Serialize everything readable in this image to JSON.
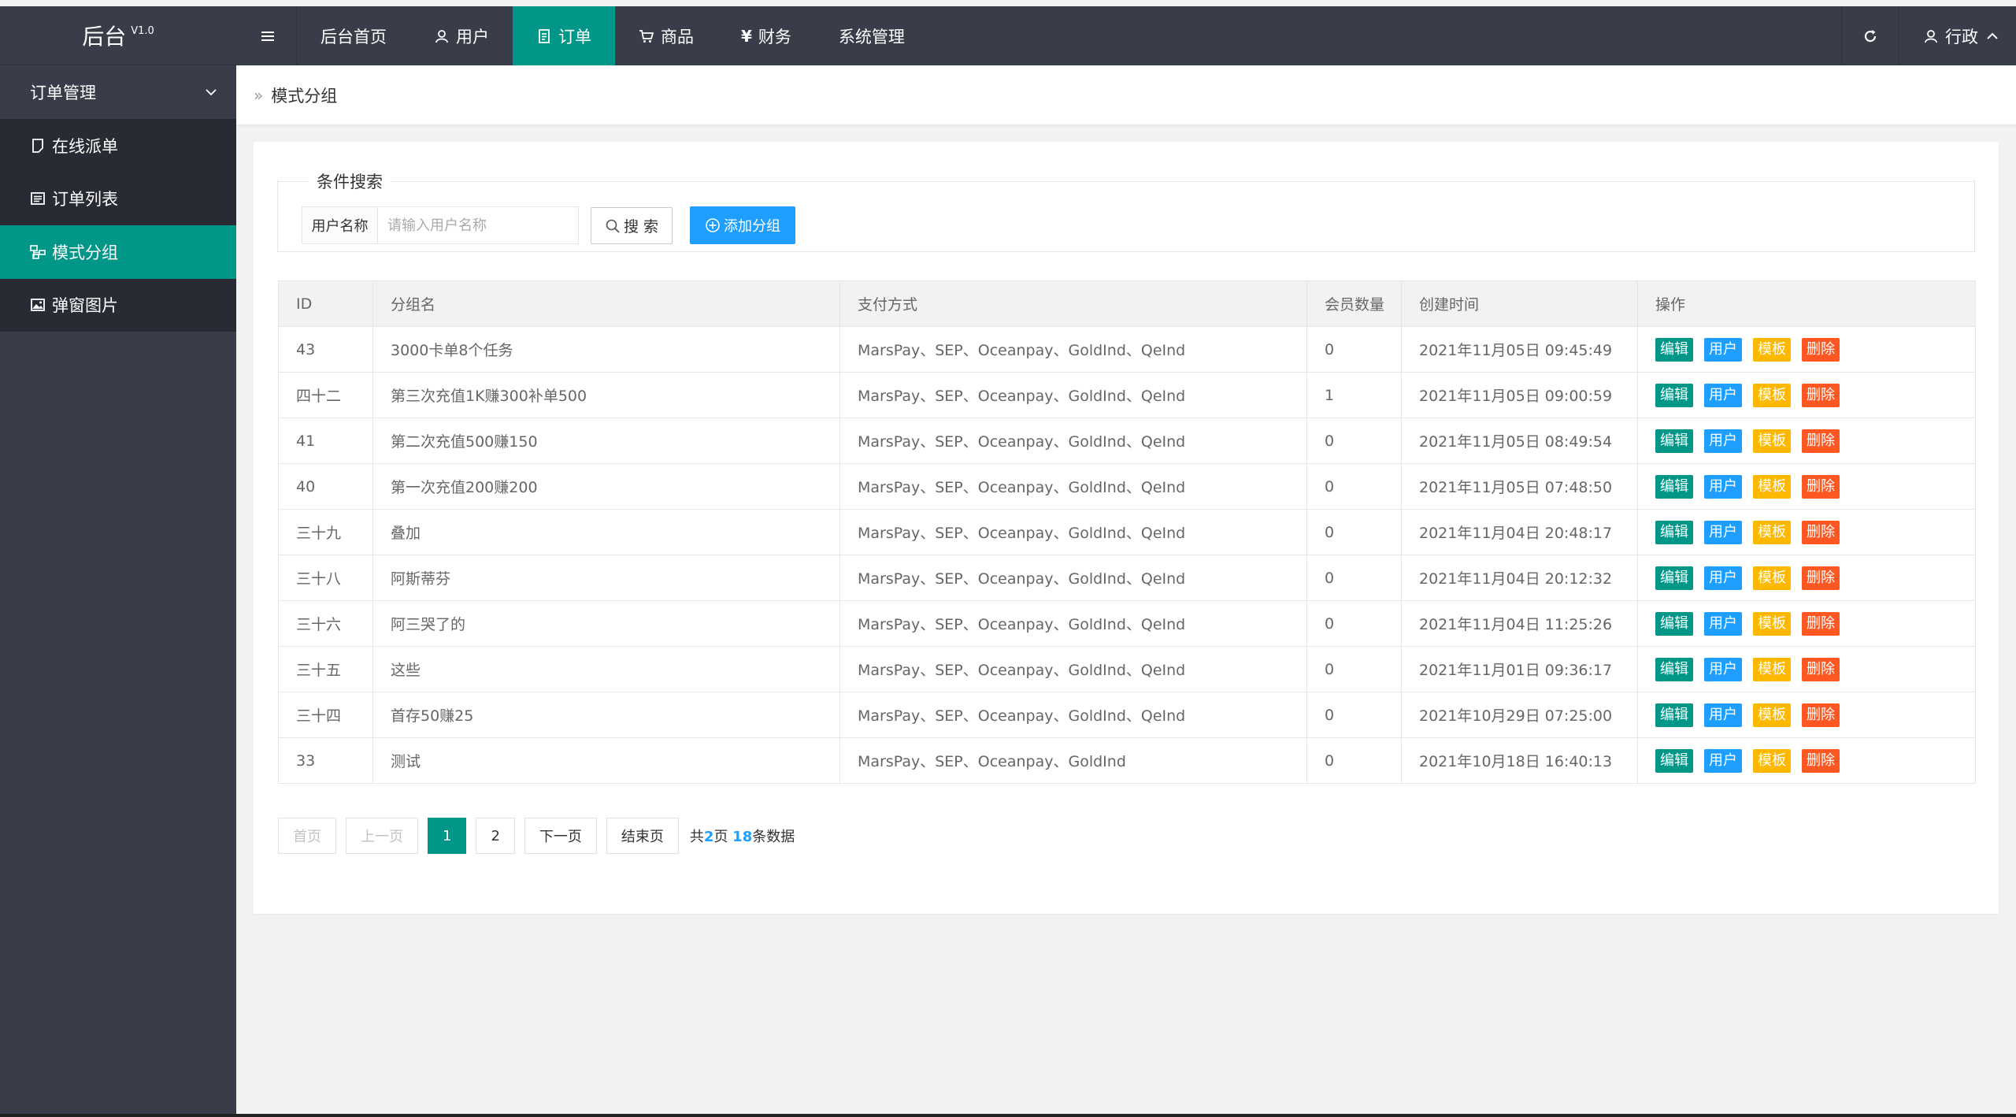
{
  "brand": {
    "name": "后台",
    "version": "V1.0"
  },
  "nav": {
    "items": [
      {
        "label": "后台首页",
        "icon": ""
      },
      {
        "label": "用户",
        "icon": "user-icon"
      },
      {
        "label": "订单",
        "icon": "document-icon",
        "active": true
      },
      {
        "label": "商品",
        "icon": "cart-icon"
      },
      {
        "label": "财务",
        "icon": "yen-icon"
      },
      {
        "label": "系统管理",
        "icon": ""
      }
    ],
    "user_label": "行政"
  },
  "sidebar": {
    "header": "订单管理",
    "items": [
      {
        "label": "在线派单",
        "icon": "note-icon"
      },
      {
        "label": "订单列表",
        "icon": "list-icon"
      },
      {
        "label": "模式分组",
        "icon": "sitemap-icon",
        "active": true
      },
      {
        "label": "弹窗图片",
        "icon": "image-icon"
      }
    ]
  },
  "breadcrumb": {
    "separator": "»",
    "current": "模式分组"
  },
  "search": {
    "legend": "条件搜索",
    "field_label": "用户名称",
    "placeholder": "请输入用户名称",
    "search_button": "搜 索",
    "add_button": "添加分组"
  },
  "table": {
    "headers": [
      "ID",
      "分组名",
      "支付方式",
      "会员数量",
      "创建时间",
      "操作"
    ],
    "actions": {
      "edit": "编辑",
      "user": "用户",
      "template": "模板",
      "delete": "删除"
    },
    "rows": [
      {
        "id": "43",
        "name": "3000卡单8个任务",
        "pay": "MarsPay、SEP、Oceanpay、GoldInd、QeInd",
        "members": "0",
        "created": "2021年11月05日 09:45:49"
      },
      {
        "id": "四十二",
        "name": "第三次充值1K赚300补单500",
        "pay": "MarsPay、SEP、Oceanpay、GoldInd、QeInd",
        "members": "1",
        "created": "2021年11月05日 09:00:59"
      },
      {
        "id": "41",
        "name": "第二次充值500赚150",
        "pay": "MarsPay、SEP、Oceanpay、GoldInd、QeInd",
        "members": "0",
        "created": "2021年11月05日 08:49:54"
      },
      {
        "id": "40",
        "name": "第一次充值200赚200",
        "pay": "MarsPay、SEP、Oceanpay、GoldInd、QeInd",
        "members": "0",
        "created": "2021年11月05日 07:48:50"
      },
      {
        "id": "三十九",
        "name": "叠加",
        "pay": "MarsPay、SEP、Oceanpay、GoldInd、QeInd",
        "members": "0",
        "created": "2021年11月04日 20:48:17"
      },
      {
        "id": "三十八",
        "name": "阿斯蒂芬",
        "pay": "MarsPay、SEP、Oceanpay、GoldInd、QeInd",
        "members": "0",
        "created": "2021年11月04日 20:12:32"
      },
      {
        "id": "三十六",
        "name": "阿三哭了的",
        "pay": "MarsPay、SEP、Oceanpay、GoldInd、QeInd",
        "members": "0",
        "created": "2021年11月04日 11:25:26"
      },
      {
        "id": "三十五",
        "name": "这些",
        "pay": "MarsPay、SEP、Oceanpay、GoldInd、QeInd",
        "members": "0",
        "created": "2021年11月01日 09:36:17"
      },
      {
        "id": "三十四",
        "name": "首存50赚25",
        "pay": "MarsPay、SEP、Oceanpay、GoldInd、QeInd",
        "members": "0",
        "created": "2021年10月29日 07:25:00"
      },
      {
        "id": "33",
        "name": "测试",
        "pay": "MarsPay、SEP、Oceanpay、GoldInd",
        "members": "0",
        "created": "2021年10月18日 16:40:13"
      }
    ]
  },
  "pager": {
    "first": "首页",
    "prev": "上一页",
    "pages": [
      "1",
      "2"
    ],
    "current": "1",
    "next": "下一页",
    "last": "结束页",
    "total_prefix": "共",
    "total_pages": "2",
    "pages_suffix": "页 ",
    "total_count": "18",
    "count_suffix": "条数据"
  },
  "colors": {
    "sidebar_bg": "#393d49",
    "accent": "#009688",
    "edit": "#009688",
    "user": "#1e9fff",
    "template": "#ffb800",
    "delete": "#ff5722"
  }
}
